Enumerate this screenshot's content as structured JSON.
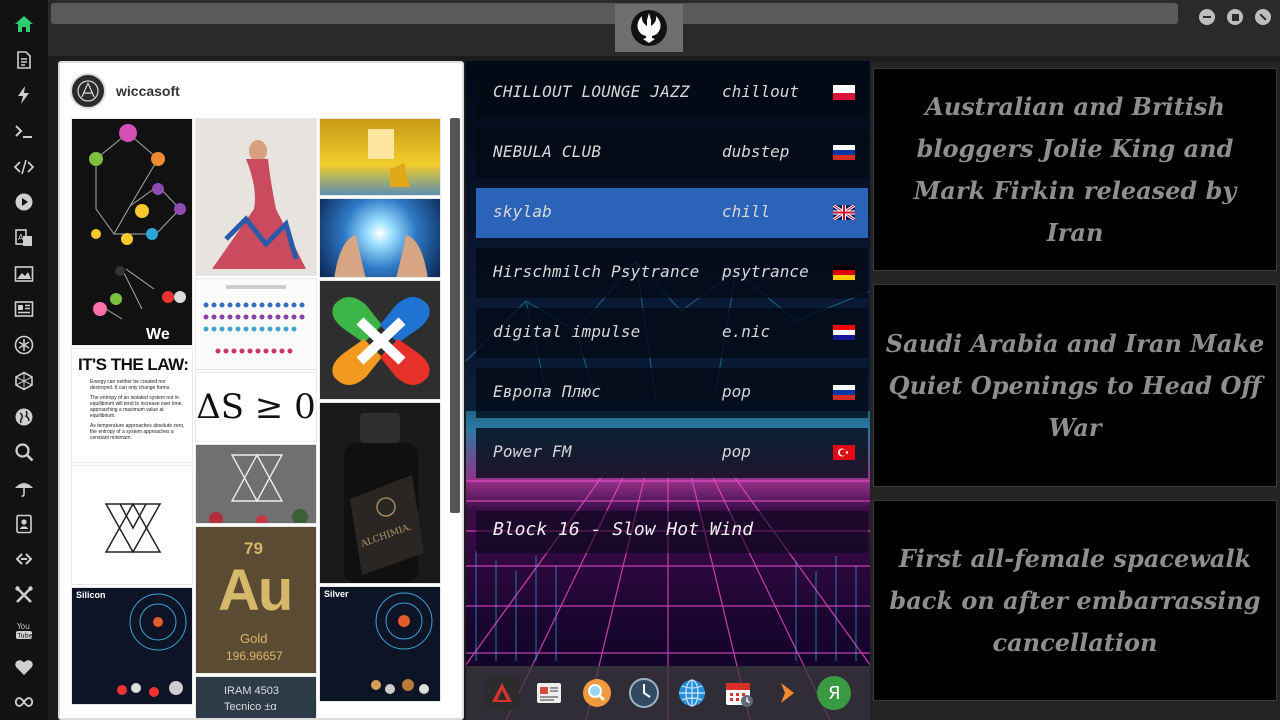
{
  "sidebar": {
    "items": [
      {
        "name": "home-icon"
      },
      {
        "name": "document-icon"
      },
      {
        "name": "flash-icon"
      },
      {
        "name": "terminal-icon"
      },
      {
        "name": "code-icon"
      },
      {
        "name": "play-icon"
      },
      {
        "name": "translate-icon"
      },
      {
        "name": "image-icon"
      },
      {
        "name": "news-icon"
      },
      {
        "name": "snowflake-icon"
      },
      {
        "name": "hexagon-icon"
      },
      {
        "name": "globe-icon"
      },
      {
        "name": "search-icon"
      },
      {
        "name": "umbrella-icon"
      },
      {
        "name": "contacts-icon"
      },
      {
        "name": "link-icon"
      },
      {
        "name": "tools-icon"
      },
      {
        "name": "youtube-icon"
      },
      {
        "name": "heart-icon"
      },
      {
        "name": "infinity-icon"
      }
    ],
    "active_color": "#2ecc71"
  },
  "topbar": {
    "logo_icon": "rebel-alliance-icon",
    "controls": [
      "minimize-icon",
      "maximize-icon",
      "close-icon"
    ]
  },
  "instagram": {
    "username": "wiccasoft",
    "tiles": {
      "its_the_law": "IT'S THE LAW:",
      "law1": "Energy can neither be created nor destroyed. It can only change forms.",
      "law2": "The entropy of an isolated system not in equilibrium will tend to increase over time, approaching a maximum value at equilibrium.",
      "law3": "As temperature approaches absolute zero, the entropy of a system approaches a constant minimum.",
      "entropy": "ΔS ≥ 0",
      "we": "We",
      "silicon": "Silicon",
      "silver": "Silver",
      "gold_number": "79",
      "gold_symbol": "Au",
      "gold_name": "Gold",
      "gold_mass": "196.96657",
      "iram_line1": "IRAM 4503",
      "iram_line2": "Tecnico ±α",
      "alchimia": "ALCHIMIA."
    }
  },
  "radio": {
    "stations": [
      {
        "name": "CHILLOUT LOUNGE JAZZ",
        "genre": "chillout",
        "flag": "poland"
      },
      {
        "name": "NEBULA CLUB",
        "genre": "dubstep",
        "flag": "russia"
      },
      {
        "name": "skylab",
        "genre": "chill",
        "flag": "uk",
        "selected": true
      },
      {
        "name": "Hirschmilch Psytrance",
        "genre": "psytrance",
        "flag": "germany"
      },
      {
        "name": "digital impulse",
        "genre": "e.nic",
        "flag": "croatia"
      },
      {
        "name": "Европа Плюс",
        "genre": "pop",
        "flag": "russia"
      },
      {
        "name": "Power FM",
        "genre": "pop",
        "flag": "turkey"
      }
    ],
    "now_playing": "Block 16 - Slow Hot Wind",
    "dock": [
      "vivaldi-icon",
      "news-reader-icon",
      "search-icon",
      "clock-icon",
      "globe-icon",
      "calendar-icon",
      "forward-icon",
      "yandex-icon"
    ],
    "dock_yandex_letter": "Я"
  },
  "news": {
    "items": [
      "Australian and British bloggers Jolie King and Mark Firkin released by Iran",
      "Saudi Arabia and Iran Make Quiet Openings to Head Off War",
      "First all-female spacewalk back on after embarrassing cancellation"
    ]
  }
}
